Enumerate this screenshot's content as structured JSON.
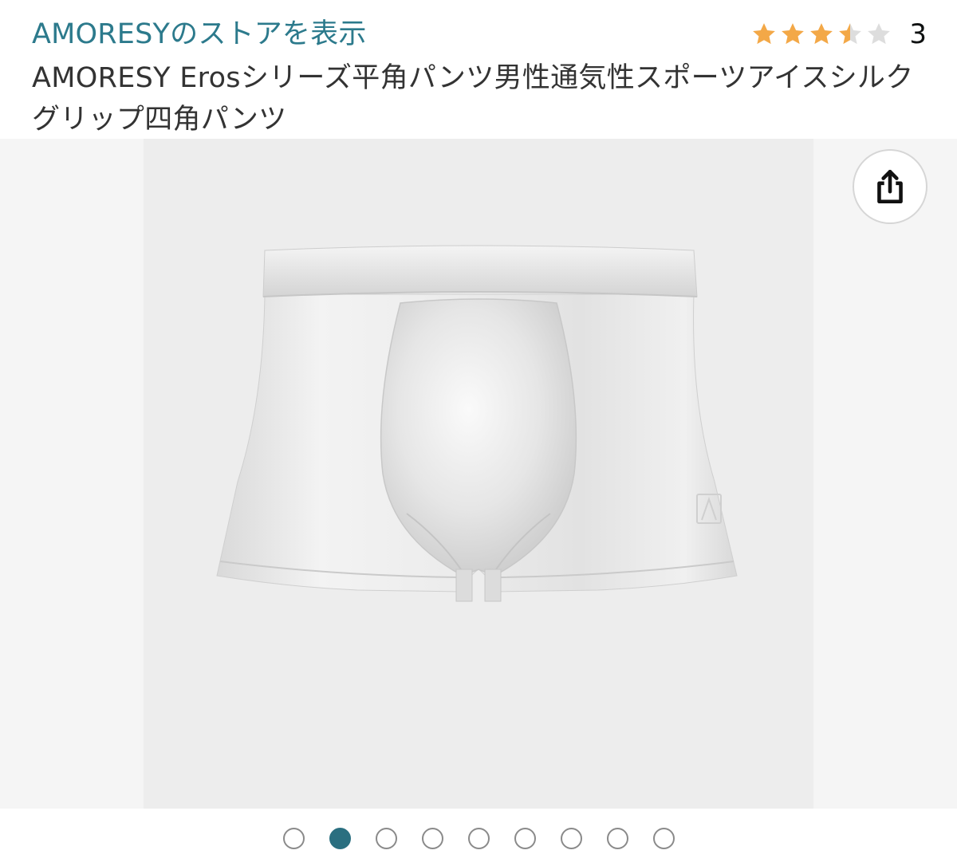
{
  "store": {
    "link_label": "AMORESYのストアを表示"
  },
  "rating": {
    "stars_value": 3.5,
    "stars_max": 5,
    "count": "3",
    "star_color": "#f3a847",
    "star_empty_color": "#dddddd"
  },
  "product": {
    "title": "AMORESY Erosシリーズ平角パンツ男性通気性スポーツアイスシルクグリップ四角パンツ"
  },
  "gallery": {
    "image_icon": "boxer-briefs-product-image",
    "share_icon": "share-icon",
    "dots_total": 9,
    "active_dot_index": 1,
    "accent_color": "#2a6f80"
  }
}
